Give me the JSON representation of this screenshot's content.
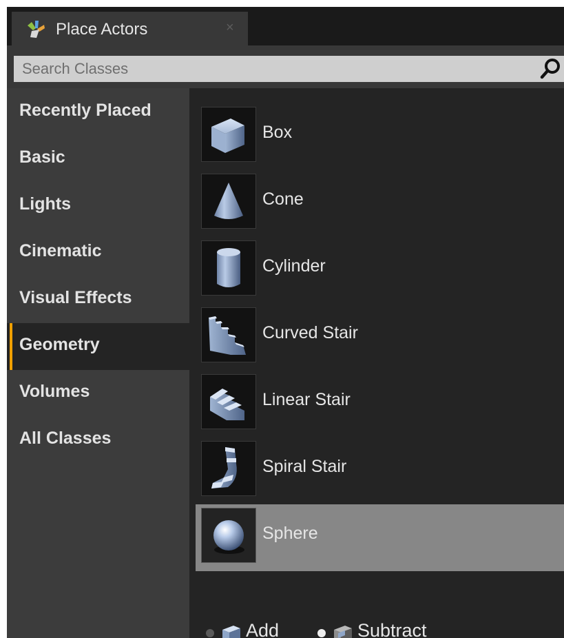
{
  "tab": {
    "title": "Place Actors",
    "close": "×"
  },
  "search": {
    "placeholder": "Search Classes"
  },
  "categories": [
    {
      "label": "Recently Placed"
    },
    {
      "label": "Basic"
    },
    {
      "label": "Lights"
    },
    {
      "label": "Cinematic"
    },
    {
      "label": "Visual Effects"
    },
    {
      "label": "Geometry",
      "active": true
    },
    {
      "label": "Volumes"
    },
    {
      "label": "All Classes"
    }
  ],
  "items": [
    {
      "label": "Box",
      "icon": "box-icon"
    },
    {
      "label": "Cone",
      "icon": "cone-icon"
    },
    {
      "label": "Cylinder",
      "icon": "cylinder-icon"
    },
    {
      "label": "Curved Stair",
      "icon": "curved-stair-icon"
    },
    {
      "label": "Linear Stair",
      "icon": "linear-stair-icon"
    },
    {
      "label": "Spiral Stair",
      "icon": "spiral-stair-icon"
    },
    {
      "label": "Sphere",
      "icon": "sphere-icon",
      "selected": true
    }
  ],
  "brush_mode": {
    "add_label": "Add",
    "subtract_label": "Subtract",
    "selected": "Subtract"
  },
  "colors": {
    "accent": "#f0a000",
    "selected_row": "#878787",
    "sidebar": "#3c3c3c",
    "list_background": "#242424"
  }
}
